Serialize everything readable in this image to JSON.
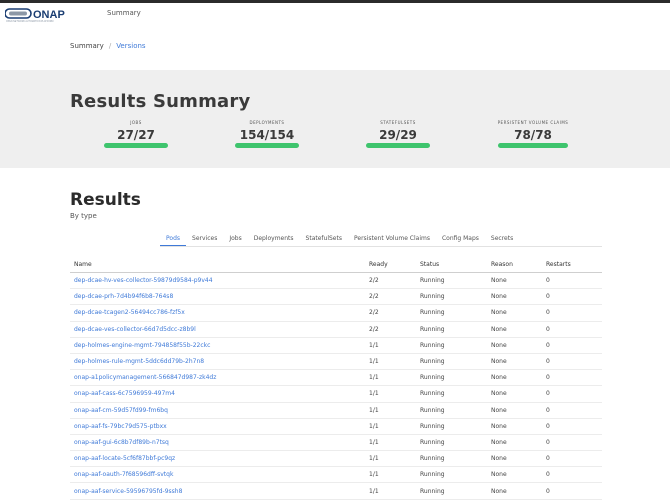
{
  "header": {
    "logo_text": "ONAP",
    "logo_tagline": "OPEN NETWORK AUTOMATION PLATFORM",
    "title": "Summary"
  },
  "breadcrumb": {
    "current": "Summary",
    "separator": "/",
    "link": "Versions"
  },
  "summary": {
    "title": "Results Summary",
    "stats": [
      {
        "label": "JOBS",
        "value": "27/27",
        "ok": 27,
        "total": 27
      },
      {
        "label": "DEPLOYMENTS",
        "value": "154/154",
        "ok": 154,
        "total": 154
      },
      {
        "label": "STATEFULSETS",
        "value": "29/29",
        "ok": 29,
        "total": 29
      },
      {
        "label": "PERSISTENT VOLUME CLAIMS",
        "value": "78/78",
        "ok": 78,
        "total": 78
      }
    ]
  },
  "results": {
    "title": "Results",
    "subtitle": "By type",
    "tabs": [
      "Pods",
      "Services",
      "Jobs",
      "Deployments",
      "StatefulSets",
      "Persistent Volume Claims",
      "Config Maps",
      "Secrets"
    ],
    "active_tab": "Pods",
    "columns": [
      "Name",
      "Ready",
      "Status",
      "Reason",
      "Restarts"
    ],
    "rows": [
      [
        "dep-dcae-hv-ves-collector-59879d9584-p9v44",
        "2/2",
        "Running",
        "None",
        "0"
      ],
      [
        "dep-dcae-prh-7d4b94f6b8-764s8",
        "2/2",
        "Running",
        "None",
        "0"
      ],
      [
        "dep-dcae-tcagen2-56494cc786-fzf5x",
        "2/2",
        "Running",
        "None",
        "0"
      ],
      [
        "dep-dcae-ves-collector-66d7d5dcc-z8b9l",
        "2/2",
        "Running",
        "None",
        "0"
      ],
      [
        "dep-holmes-engine-mgmt-794858f55b-22ckc",
        "1/1",
        "Running",
        "None",
        "0"
      ],
      [
        "dep-holmes-rule-mgmt-5ddc6dd79b-2h7n8",
        "1/1",
        "Running",
        "None",
        "0"
      ],
      [
        "onap-a1policymanagement-566847d987-zk4dz",
        "1/1",
        "Running",
        "None",
        "0"
      ],
      [
        "onap-aaf-cass-6c7596959-497m4",
        "1/1",
        "Running",
        "None",
        "0"
      ],
      [
        "onap-aaf-cm-59d57fd99-fm6bq",
        "1/1",
        "Running",
        "None",
        "0"
      ],
      [
        "onap-aaf-fs-79bc79d575-ptbxx",
        "1/1",
        "Running",
        "None",
        "0"
      ],
      [
        "onap-aaf-gui-6c8b7df89b-n7tsq",
        "1/1",
        "Running",
        "None",
        "0"
      ],
      [
        "onap-aaf-locate-5cf6f87bbf-pc9qz",
        "1/1",
        "Running",
        "None",
        "0"
      ],
      [
        "onap-aaf-oauth-7f68596dff-svtqk",
        "1/1",
        "Running",
        "None",
        "0"
      ],
      [
        "onap-aaf-service-59596795fd-9ssh8",
        "1/1",
        "Running",
        "None",
        "0"
      ]
    ]
  },
  "colors": {
    "accent": "#3f7ad8",
    "ok_bar": "#3ec46d",
    "band": "#efefef",
    "logo_navy": "#1a3d72",
    "logo_grey": "#8d98a6"
  }
}
